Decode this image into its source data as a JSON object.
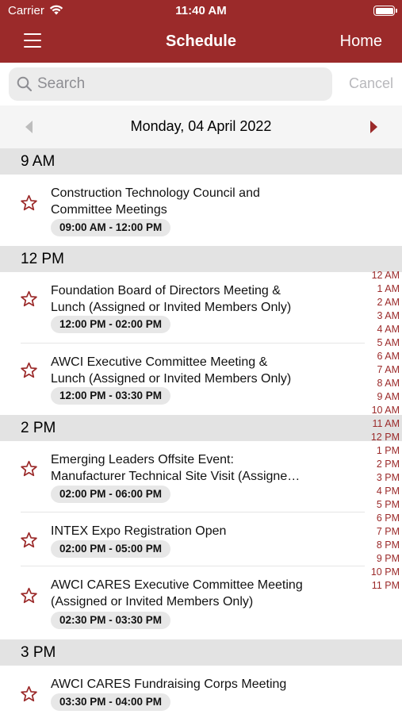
{
  "status_bar": {
    "carrier": "Carrier",
    "time": "11:40 AM"
  },
  "nav": {
    "title": "Schedule",
    "home_label": "Home"
  },
  "search": {
    "placeholder": "Search",
    "cancel_label": "Cancel"
  },
  "date_bar": {
    "date": "Monday, 04 April 2022"
  },
  "colors": {
    "brand": "#9b2a2a",
    "section_bg": "#e3e3e3",
    "pill_bg": "#e7e7e7"
  },
  "sections": [
    {
      "label": "9 AM",
      "events": [
        {
          "title_lines": [
            "Construction Technology Council and",
            "Committee Meetings"
          ],
          "time": "09:00 AM - 12:00 PM"
        }
      ]
    },
    {
      "label": "12 PM",
      "events": [
        {
          "title_lines": [
            "Foundation Board of Directors Meeting &",
            "Lunch (Assigned or Invited Members Only)"
          ],
          "time": "12:00 PM - 02:00 PM"
        },
        {
          "title_lines": [
            "AWCI Executive Committee Meeting &",
            "Lunch (Assigned or Invited Members Only)"
          ],
          "time": "12:00 PM - 03:30 PM"
        }
      ]
    },
    {
      "label": "2 PM",
      "events": [
        {
          "title_lines": [
            "Emerging Leaders Offsite Event:",
            "Manufacturer Technical Site Visit (Assigne…"
          ],
          "time": "02:00 PM - 06:00 PM"
        },
        {
          "title_lines": [
            "INTEX Expo Registration Open"
          ],
          "time": "02:00 PM - 05:00 PM"
        },
        {
          "title_lines": [
            "AWCI CARES Executive Committee Meeting",
            "(Assigned or Invited Members Only)"
          ],
          "time": "02:30 PM - 03:30 PM"
        }
      ]
    },
    {
      "label": "3 PM",
      "events": [
        {
          "title_lines": [
            "AWCI CARES Fundraising Corps Meeting"
          ],
          "time": "03:30 PM - 04:00 PM"
        }
      ]
    }
  ],
  "hour_index": [
    "12 AM",
    "1 AM",
    "2 AM",
    "3 AM",
    "4 AM",
    "5 AM",
    "6 AM",
    "7 AM",
    "8 AM",
    "9 AM",
    "10 AM",
    "11 AM",
    "12 PM",
    "1 PM",
    "2 PM",
    "3 PM",
    "4 PM",
    "5 PM",
    "6 PM",
    "7 PM",
    "8 PM",
    "9 PM",
    "10 PM",
    "11 PM"
  ]
}
